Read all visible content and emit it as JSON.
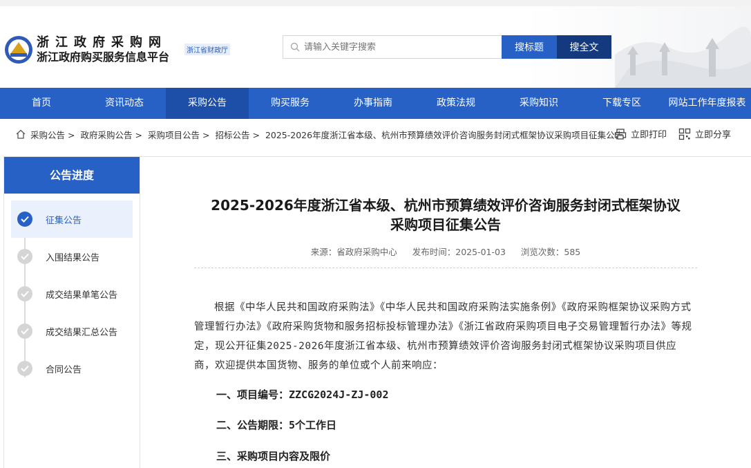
{
  "header": {
    "site_title": "浙江政府采购网",
    "site_subtitle": "浙江政府购买服务信息平台",
    "badge": "浙江省财政厅",
    "search_placeholder": "请输入关键字搜索",
    "search_title_btn": "搜标题",
    "search_full_btn": "搜全文"
  },
  "nav": {
    "items": [
      "首页",
      "资讯动态",
      "采购公告",
      "购买服务",
      "办事指南",
      "政策法规",
      "采购知识",
      "下载专区",
      "网站工作年度报表"
    ],
    "active_index": 2
  },
  "breadcrumb": {
    "items": [
      "采购公告",
      "政府采购公告",
      "采购项目公告",
      "招标公告",
      "2025-2026年度浙江省本级、杭州市预算绩效评价咨询服务封闭式框架协议采购项目征集公告"
    ],
    "print_label": "立即打印",
    "share_label": "立即分享"
  },
  "sidebar": {
    "title": "公告进度",
    "steps": [
      "征集公告",
      "入围结果公告",
      "成交结果单笔公告",
      "成交结果汇总公告",
      "合同公告"
    ],
    "active_index": 0
  },
  "article": {
    "title_line1": "2025-2026年度浙江省本级、杭州市预算绩效评价咨询服务封闭式框架协议",
    "title_line2": "采购项目征集公告",
    "source": "来源：省政府采购中心",
    "publish_time": "发布时间：2025-01-03",
    "views": "浏览次数：585",
    "body": "根据《中华人民共和国政府采购法》《中华人民共和国政府采购法实施条例》《政府采购框架协议采购方式管理暂行办法》《政府采购货物和服务招标投标管理办法》《浙江省政府采购项目电子交易管理暂行办法》等规定，现公开征集2025-2026年度浙江省本级、杭州市预算绩效评价咨询服务封闭式框架协议采购项目供应商，欢迎提供本国货物、服务的单位或个人前来响应：",
    "section1": "一、项目编号：ZZCG2024J-ZJ-002",
    "section2": "二、公告期限：5个工作日",
    "section3": "三、采购项目内容及限价"
  },
  "colors": {
    "primary": "#2861c5",
    "primary_dark": "#15397f",
    "nav_active": "#1d4fa8"
  }
}
